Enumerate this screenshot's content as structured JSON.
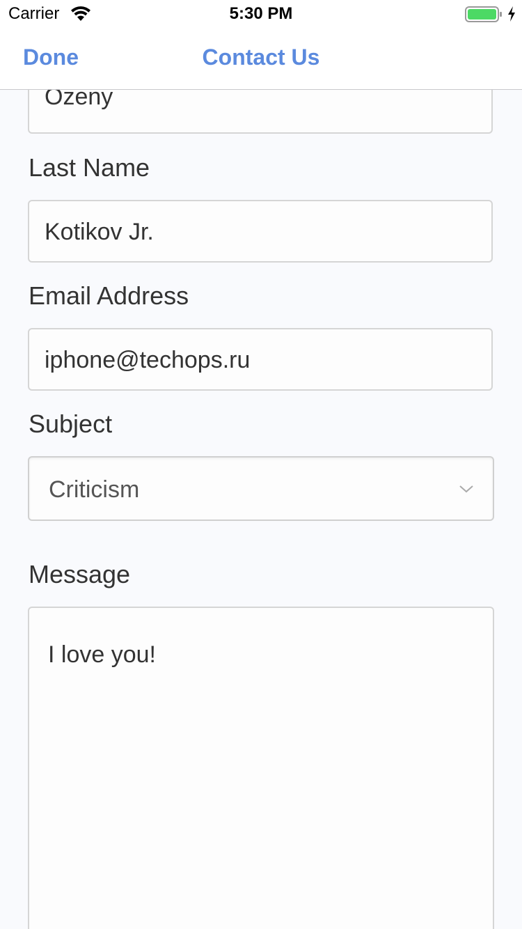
{
  "status_bar": {
    "carrier": "Carrier",
    "time": "5:30 PM",
    "wifi_icon": "wifi-icon",
    "battery_icon": "battery-full-icon",
    "charging_icon": "charging-bolt-icon"
  },
  "nav": {
    "done_label": "Done",
    "title": "Contact Us"
  },
  "form": {
    "first_name": {
      "value": "Ozeny"
    },
    "last_name": {
      "label": "Last Name",
      "value": "Kotikov Jr."
    },
    "email": {
      "label": "Email Address",
      "value": "iphone@techops.ru"
    },
    "subject": {
      "label": "Subject",
      "selected": "Criticism",
      "dropdown_icon": "chevron-down-icon"
    },
    "message": {
      "label": "Message",
      "value": "I love you!"
    }
  },
  "colors": {
    "accent": "#5b8ade",
    "background": "#f9fafd",
    "text": "#333333",
    "field_border": "#d5d5d5",
    "battery_fill": "#4cd964"
  }
}
